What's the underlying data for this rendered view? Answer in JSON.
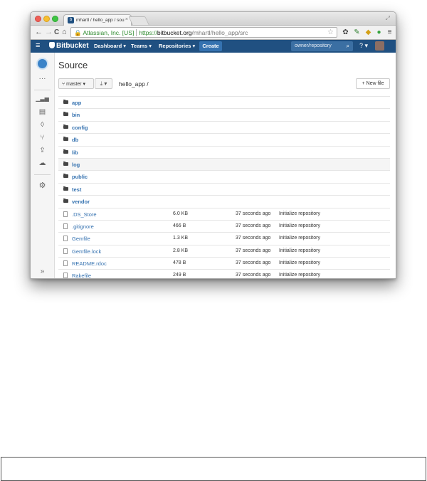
{
  "browser": {
    "tab_title": "mhartl / hello_app / sou",
    "tab_close": "×",
    "ev_label": "Atlassian, Inc. [US]",
    "url_scheme": "https://",
    "url_host": "bitbucket.org",
    "url_path": "/mhartl/hello_app/src",
    "nav_back": "←",
    "nav_forward": "→",
    "nav_reload": "C",
    "nav_home": "⌂",
    "menu": "≡"
  },
  "header": {
    "logo": "Bitbucket",
    "nav": [
      {
        "label": "Dashboard ▾"
      },
      {
        "label": "Teams ▾"
      },
      {
        "label": "Repositories ▾"
      }
    ],
    "create": "Create",
    "search_placeholder": "owner/repository",
    "help": "? ▾"
  },
  "source": {
    "title": "Source",
    "branch": "master ▾",
    "download": "⤓ ▾",
    "path": "hello_app /",
    "new_file": "+ New file",
    "folders": [
      "app",
      "bin",
      "config",
      "db",
      "lib",
      "log",
      "public",
      "test",
      "vendor"
    ],
    "files": [
      {
        "name": ".DS_Store",
        "size": "6.0 KB",
        "time": "37 seconds ago",
        "message": "Initialize repository"
      },
      {
        "name": ".gitignore",
        "size": "466 B",
        "time": "37 seconds ago",
        "message": "Initialize repository"
      },
      {
        "name": "Gemfile",
        "size": "1.3 KB",
        "time": "37 seconds ago",
        "message": "Initialize repository"
      },
      {
        "name": "Gemfile.lock",
        "size": "2.8 KB",
        "time": "37 seconds ago",
        "message": "Initialize repository"
      },
      {
        "name": "README.rdoc",
        "size": "478 B",
        "time": "37 seconds ago",
        "message": "Initialize repository"
      },
      {
        "name": "Rakefile",
        "size": "249 B",
        "time": "37 seconds ago",
        "message": "Initialize repository"
      }
    ]
  },
  "sidebar": {
    "more": "···",
    "collapse": "»"
  },
  "colors": {
    "header_bg": "#205081",
    "link": "#3572b0",
    "create_bg": "#3572b0"
  }
}
